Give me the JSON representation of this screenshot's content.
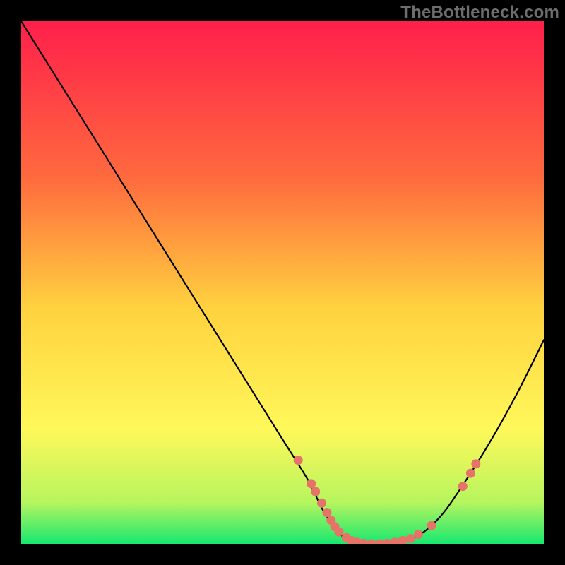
{
  "watermark": "TheBottleneck.com",
  "chart_data": {
    "type": "line",
    "title": "",
    "xlabel": "",
    "ylabel": "",
    "xlim": [
      0,
      100
    ],
    "ylim": [
      0,
      100
    ],
    "grid": false,
    "legend": false,
    "background_gradient": {
      "stops": [
        {
          "offset": 0.0,
          "color": "#ff1f4b"
        },
        {
          "offset": 0.3,
          "color": "#ff6a3e"
        },
        {
          "offset": 0.55,
          "color": "#ffd23f"
        },
        {
          "offset": 0.78,
          "color": "#fff85a"
        },
        {
          "offset": 0.92,
          "color": "#b7f55e"
        },
        {
          "offset": 1.0,
          "color": "#17e86f"
        }
      ]
    },
    "series": [
      {
        "name": "bottleneck-curve",
        "color": "#000000",
        "x": [
          0,
          5,
          10,
          15,
          20,
          25,
          30,
          35,
          40,
          45,
          50,
          55,
          58,
          62,
          66,
          70,
          75,
          80,
          85,
          90,
          95,
          100
        ],
        "y": [
          100,
          92,
          84,
          76,
          68,
          60,
          52,
          44,
          36,
          28,
          20,
          12,
          6,
          1,
          0,
          0,
          1,
          5,
          12,
          20,
          29,
          39
        ]
      }
    ],
    "markers": {
      "name": "data-points",
      "color": "#e57368",
      "points": [
        {
          "x": 53.0,
          "y": 16.0
        },
        {
          "x": 55.5,
          "y": 11.5
        },
        {
          "x": 56.3,
          "y": 10.0
        },
        {
          "x": 57.5,
          "y": 7.8
        },
        {
          "x": 58.5,
          "y": 6.0
        },
        {
          "x": 59.3,
          "y": 4.5
        },
        {
          "x": 60.0,
          "y": 3.3
        },
        {
          "x": 60.8,
          "y": 2.3
        },
        {
          "x": 62.2,
          "y": 1.2
        },
        {
          "x": 63.2,
          "y": 0.6
        },
        {
          "x": 64.3,
          "y": 0.3
        },
        {
          "x": 65.5,
          "y": 0.1
        },
        {
          "x": 67.0,
          "y": 0.0
        },
        {
          "x": 68.5,
          "y": 0.0
        },
        {
          "x": 70.0,
          "y": 0.1
        },
        {
          "x": 71.5,
          "y": 0.3
        },
        {
          "x": 73.0,
          "y": 0.6
        },
        {
          "x": 74.5,
          "y": 1.0
        },
        {
          "x": 76.0,
          "y": 1.8
        },
        {
          "x": 78.5,
          "y": 3.5
        },
        {
          "x": 84.5,
          "y": 11.0
        },
        {
          "x": 86.0,
          "y": 13.5
        },
        {
          "x": 87.0,
          "y": 15.3
        }
      ]
    }
  }
}
